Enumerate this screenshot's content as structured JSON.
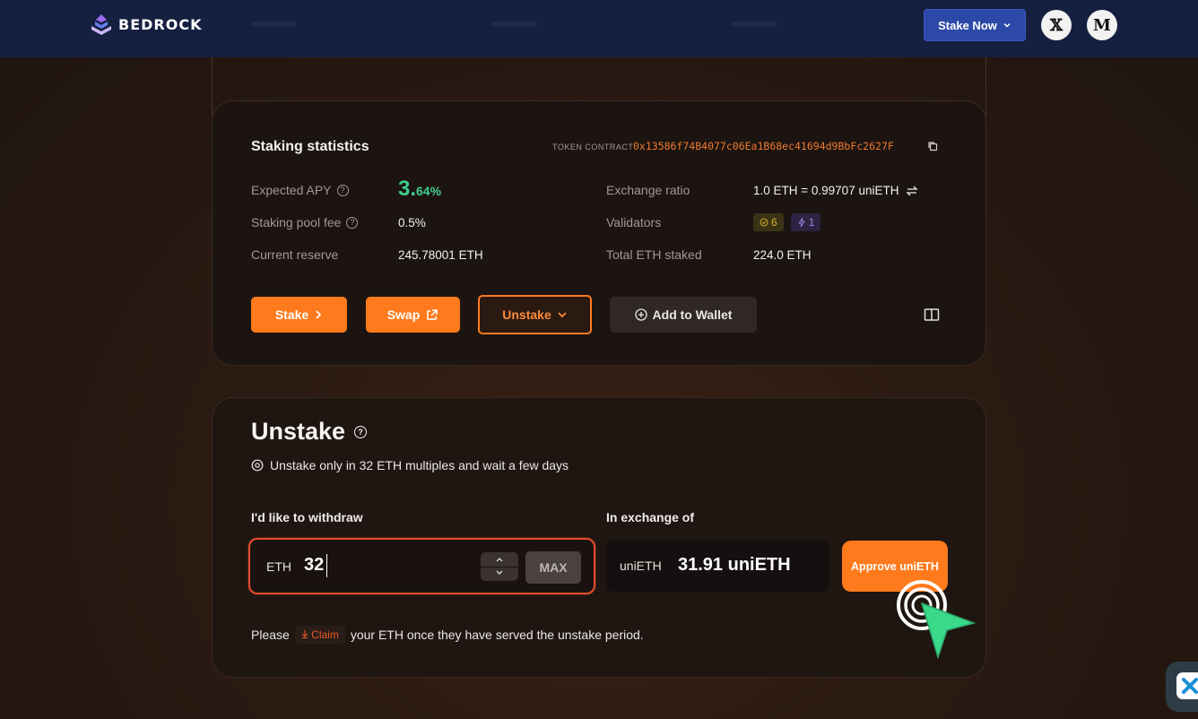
{
  "nav": {
    "brand": "BEDROCK",
    "stake_now_label": "Stake Now",
    "x_icon_label": "𝕏",
    "medium_icon_label": "M",
    "icons": [
      "bedrock-logo",
      "chevron-down-icon",
      "x-twitter-icon",
      "medium-icon"
    ]
  },
  "stats": {
    "title": "Staking statistics",
    "contract_label": "TOKEN CONTRACT",
    "contract_address": "0x13586f74B4077c06Ea1B68ec41694d9BbFc2627F",
    "expected_apy_label": "Expected APY",
    "expected_apy_int": "3.",
    "expected_apy_dec": "64%",
    "pool_fee_label": "Staking pool fee",
    "pool_fee_value": "0.5%",
    "reserve_label": "Current reserve",
    "reserve_value": "245.78001 ETH",
    "exchange_ratio_label": "Exchange ratio",
    "exchange_ratio_value": "1.0 ETH = 0.99707 uniETH",
    "validators_label": "Validators",
    "validators_active": "6",
    "validators_pending": "1",
    "total_staked_label": "Total ETH staked",
    "total_staked_value": "224.0 ETH"
  },
  "actions": {
    "stake_label": "Stake",
    "swap_label": "Swap",
    "unstake_label": "Unstake",
    "add_wallet_label": "Add to Wallet"
  },
  "unstake": {
    "title": "Unstake",
    "note": "Unstake only in 32 ETH multiples and wait a few days",
    "withdraw_label": "I'd like to withdraw",
    "exchange_label": "In exchange of",
    "input_unit": "ETH",
    "input_value": "32",
    "max_label": "MAX",
    "output_unit": "uniETH",
    "output_value": "31.91 uniETH",
    "approve_label": "Approve uniETH",
    "claim_prefix": "Please",
    "claim_chip": "Claim",
    "claim_suffix": "your ETH once they have served the unstake period."
  },
  "colors": {
    "accent": "#ff7a1c",
    "apy_green": "#3fce8f",
    "nav_bg": "#152040",
    "contract_orange": "#f07a2c"
  }
}
